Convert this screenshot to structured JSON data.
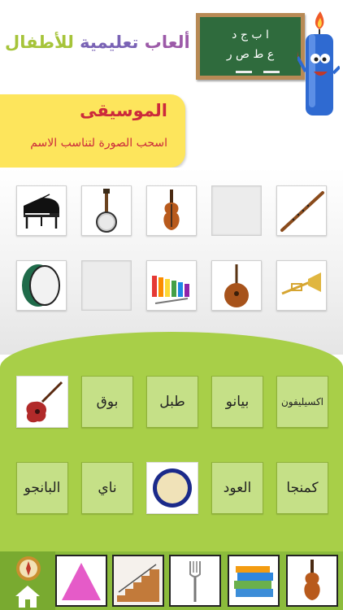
{
  "header": {
    "title_words": [
      "ألعاب",
      "تعليمية",
      "للأطفال"
    ],
    "board_rows": [
      "ا ب ج د",
      "ع ط ص ر"
    ]
  },
  "banner": {
    "category": "الموسيقى",
    "instruction": "اسحب الصورة لتناسب الاسم"
  },
  "grid": {
    "row1": [
      "piano-image",
      "banjo-image",
      "violin-image",
      "empty-slot",
      "flute-image"
    ],
    "row2": [
      "drum-image",
      "empty-slot",
      "xylophone-image",
      "oud-image",
      "trumpet-image"
    ]
  },
  "answers": {
    "row1": [
      "guitar-image",
      "بوق",
      "طبل",
      "بيانو",
      "اكسيليفون"
    ],
    "row2": [
      "البانجو",
      "ناي",
      "tambourine-image",
      "العود",
      "كمنجا"
    ]
  },
  "bottom_nav": {
    "items": [
      "compass-icon",
      "home-icon",
      "triangle-thumbnail",
      "stairs-thumbnail",
      "fork-thumbnail",
      "books-thumbnail",
      "violin-thumbnail"
    ]
  },
  "colors": {
    "accent_green": "#a8cf48",
    "banner_yellow": "#fde55c",
    "banner_text": "#cc2a3b",
    "board_green": "#2f6b3d"
  }
}
